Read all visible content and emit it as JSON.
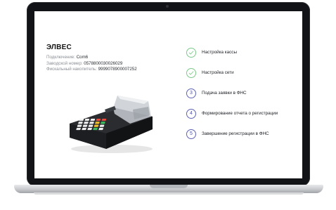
{
  "device": {
    "title": "ЭЛВЕС",
    "connection_label": "Подключение:",
    "connection_value": "Com6",
    "serial_label": "Заводской номер:",
    "serial_value": "0578800030026029",
    "fn_label": "Фискальный накопитель:",
    "fn_value": "9999078900007252"
  },
  "steps": [
    {
      "label": "Настройка кассы",
      "status": "done"
    },
    {
      "label": "Настройка сети",
      "status": "done"
    },
    {
      "number": "3",
      "label": "Подача заявки в ФНС",
      "status": "pending"
    },
    {
      "number": "4",
      "label": "Формирование отчета о регистрации",
      "status": "pending"
    },
    {
      "number": "5",
      "label": "Завершение регистрации в ФНС",
      "status": "pending"
    }
  ],
  "colors": {
    "done": "#7cc98a",
    "pending": "#5e63b3",
    "bezel": "#121316"
  },
  "icons": {
    "done": "check-icon"
  }
}
